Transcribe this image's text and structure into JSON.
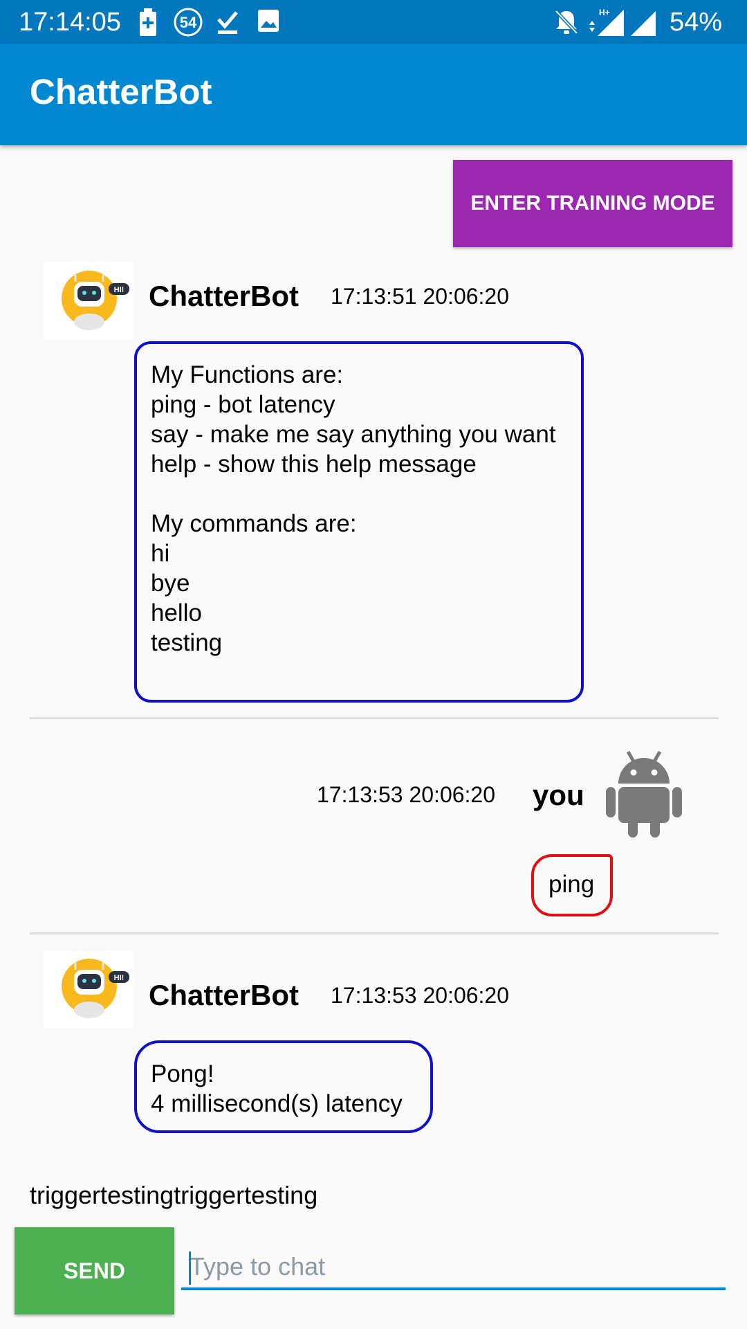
{
  "status_bar": {
    "time": "17:14:05",
    "notification_badge": "54",
    "battery": "54%",
    "network": "H+"
  },
  "app_bar": {
    "title": "ChatterBot"
  },
  "training_button": {
    "label": "ENTER TRAINING MODE"
  },
  "messages": [
    {
      "sender": "ChatterBot",
      "timestamp": "17:13:51 20:06:20",
      "text": "My Functions are:\nping - bot latency\nsay - make me say anything you want\nhelp - show this help message\n\nMy commands are:\nhi\nbye\nhello\ntesting"
    },
    {
      "sender": "you",
      "timestamp": "17:13:53 20:06:20",
      "text": "ping"
    },
    {
      "sender": "ChatterBot",
      "timestamp": "17:13:53 20:06:20",
      "text": "Pong!\n4 millisecond(s) latency"
    }
  ],
  "bot_avatar_badge": "HI!",
  "trigger_text": "triggertestingtriggertesting",
  "composer": {
    "send_label": "SEND",
    "placeholder": "Type to chat",
    "value": ""
  },
  "colors": {
    "status_bar": "#0277bd",
    "app_bar": "#0288d1",
    "training_button": "#9c27b0",
    "send_button": "#4caf50",
    "bot_bubble_border": "#1010cc",
    "user_bubble_border": "#e01010"
  },
  "icons": {
    "status_left": [
      "battery-plus-icon",
      "notification-count-icon",
      "check-download-icon",
      "image-icon"
    ],
    "status_right": [
      "bell-off-icon",
      "signal-h-plus-icon",
      "signal-icon"
    ],
    "bot_avatar": "robot-avatar-icon",
    "user_avatar": "android-robot-icon"
  }
}
